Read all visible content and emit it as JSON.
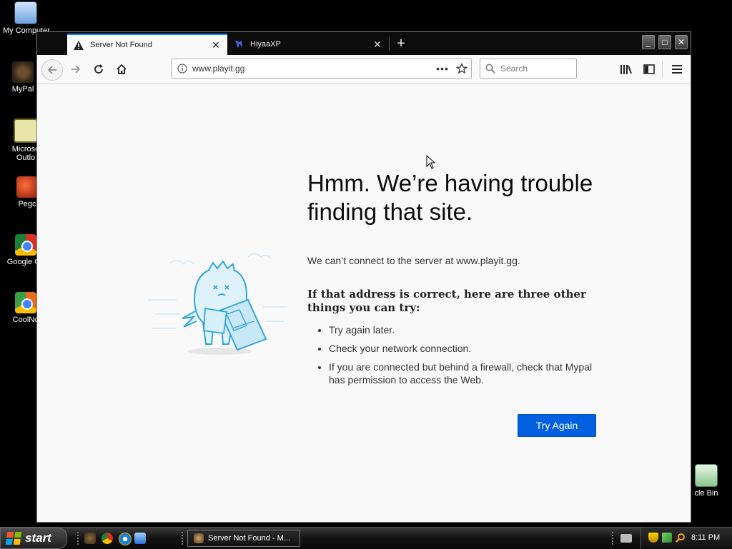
{
  "desktop": {
    "icons": [
      {
        "label": "My Computer",
        "icon": "my-computer-icon"
      },
      {
        "label": "MyPal",
        "icon": "mypal-icon"
      },
      {
        "label": "Microso",
        "label2": "Outlo",
        "icon": "outlook-icon"
      },
      {
        "label": "Pegc",
        "icon": "pegc-icon"
      },
      {
        "label": "Google Ch",
        "icon": "google-chrome-icon"
      },
      {
        "label": "CoolNo",
        "icon": "coolnovo-icon"
      },
      {
        "label": "cle Bin",
        "icon": "recycle-bin-icon"
      }
    ]
  },
  "browser": {
    "tabs": [
      {
        "title": "Server Not Found",
        "icon": "warning-icon",
        "active": true
      },
      {
        "title": "HiyaaXP",
        "icon": "hiyaaxp-icon",
        "active": false
      }
    ],
    "new_tab_symbol": "+",
    "window_controls": {
      "minimize": "_",
      "maximize": "□",
      "close": "✕"
    },
    "url": "www.playit.gg",
    "page_actions": "•••",
    "search_placeholder": "Search"
  },
  "error_page": {
    "title": "Hmm. We’re having trouble finding that site.",
    "description": "We can’t connect to the server at www.playit.gg.",
    "subtitle": "If that address is correct, here are three other things you can try:",
    "suggestions": [
      "Try again later.",
      "Check your network connection.",
      "If you are connected but behind a firewall, check that Mypal has permission to access the Web."
    ],
    "button_label": "Try Again",
    "button_color": "#0060df"
  },
  "taskbar": {
    "start_label": "start",
    "task_buttons": [
      {
        "label": "Server Not Found - M...",
        "icon": "mypal-icon"
      }
    ],
    "clock": "8:11 PM"
  }
}
